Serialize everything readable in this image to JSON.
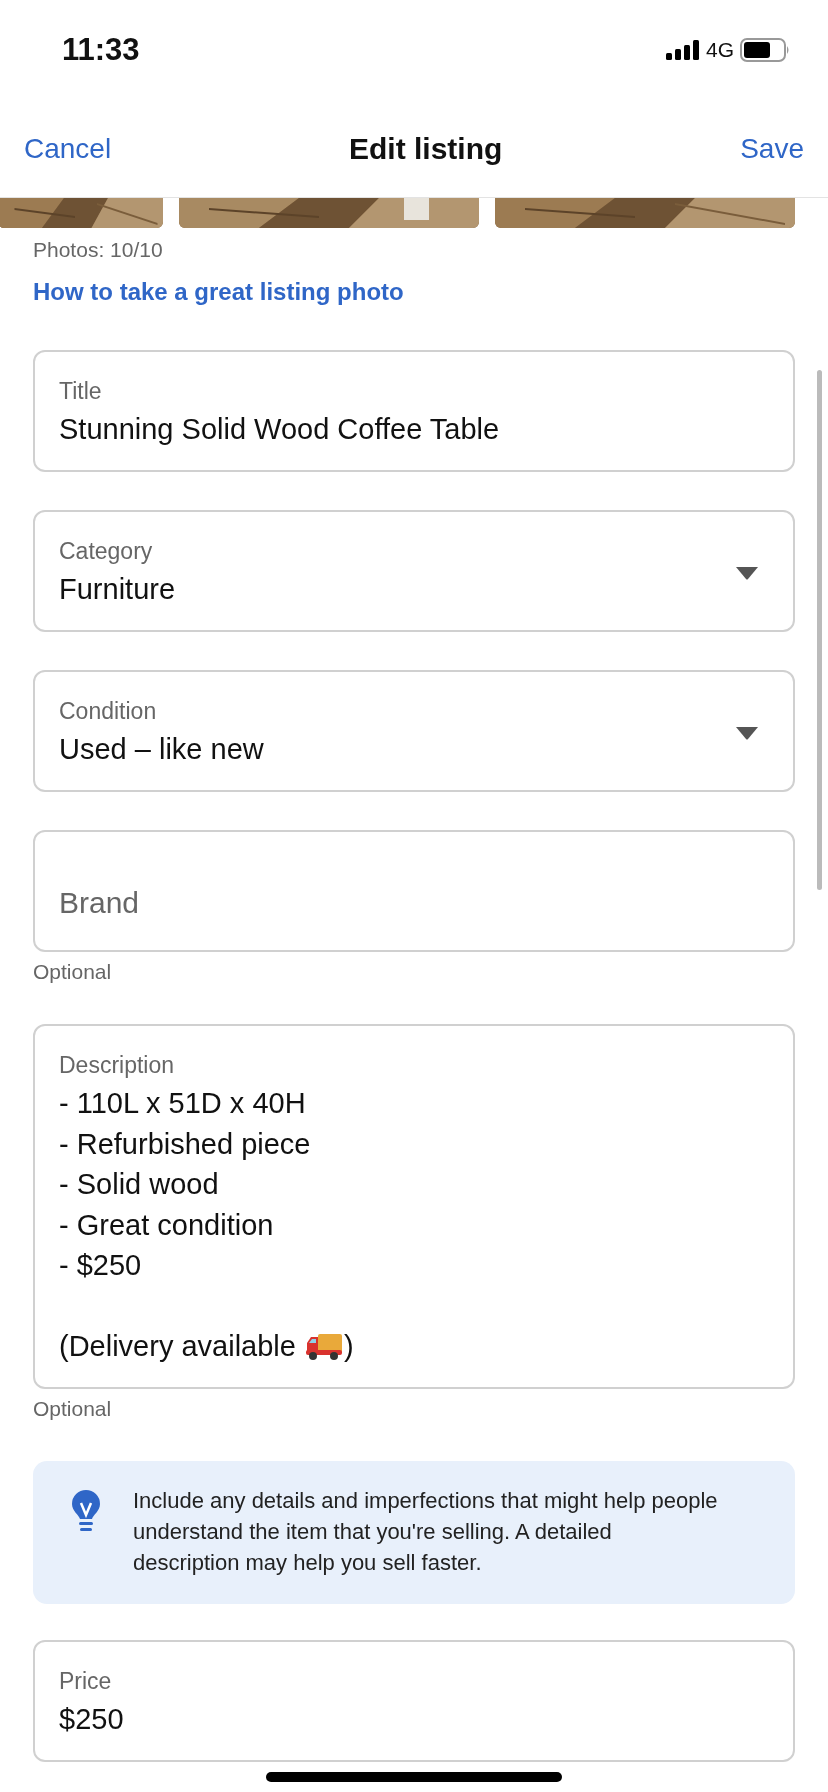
{
  "status_bar": {
    "time": "11:33",
    "network": "4G"
  },
  "nav": {
    "cancel": "Cancel",
    "title": "Edit listing",
    "save": "Save"
  },
  "photos": {
    "count": "Photos: 10/10",
    "help_link": "How to take a great listing photo"
  },
  "fields": [
    {
      "kind": "text",
      "label": "Title",
      "value": "Stunning Solid Wood Coffee Table"
    },
    {
      "kind": "dropdown",
      "label": "Category",
      "value": "Furniture"
    },
    {
      "kind": "dropdown",
      "label": "Condition",
      "value": "Used – like new"
    },
    {
      "kind": "empty",
      "placeholder": "Brand",
      "hint": "Optional"
    },
    {
      "kind": "multiline",
      "label": "Description",
      "lines": [
        {
          "text": "- 110L x 51D x 40H"
        },
        {
          "text": "- Refurbished piece"
        },
        {
          "text": "- Solid wood"
        },
        {
          "text": "- Great condition"
        },
        {
          "text": "- $250"
        },
        {
          "kind": "blank"
        },
        {
          "kind": "truck",
          "text": "(Delivery available",
          "after": ")"
        }
      ],
      "hint": "Optional"
    },
    {
      "kind": "tip",
      "text": "Include any details and imperfections that might help people understand the item that you're selling. A detailed description may help you sell faster."
    },
    {
      "kind": "text",
      "label": "Price",
      "value": "$250"
    }
  ]
}
